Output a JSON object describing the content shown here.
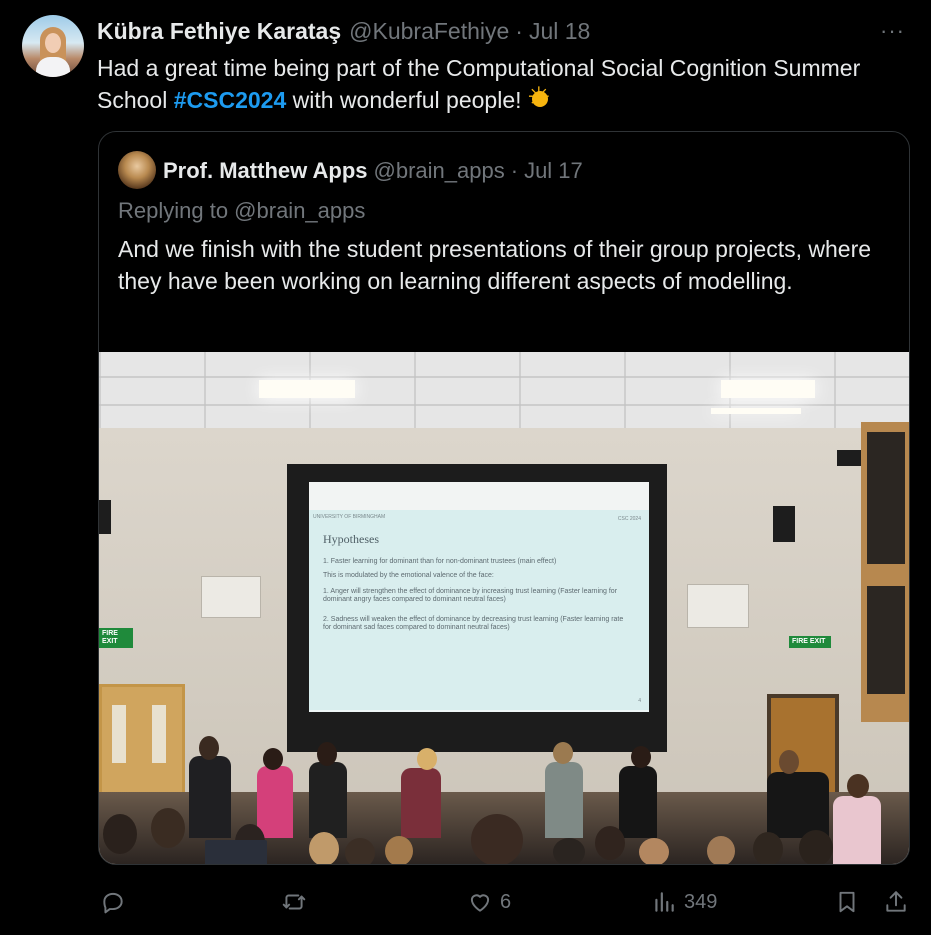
{
  "author": {
    "name": "Kübra Fethiye Karataş",
    "handle": "@KubraFethiye",
    "separator": "·",
    "date": "Jul 18"
  },
  "more_label": "···",
  "tweet": {
    "text_before": "Had a great time being part of the Computational Social Cognition Summer School ",
    "hashtag": "#CSC2024",
    "text_after": " with wonderful people!"
  },
  "quoted": {
    "name": "Prof. Matthew Apps",
    "handle": "@brain_apps",
    "separator": "·",
    "date": "Jul 17",
    "replying": "Replying to @brain_apps",
    "text": "And we finish with the student presentations of their group projects, where they have been working on learning different aspects of modelling."
  },
  "slide": {
    "logo": "UNIVERSITY OF BIRMINGHAM",
    "tag": "CSC 2024",
    "title": "Hypotheses",
    "line1": "1.   Faster learning for dominant than for non-dominant trustees (main effect)",
    "line2": "This is modulated by the emotional valence of the face:",
    "line3": "1.   Anger will strengthen the effect of dominance by increasing trust learning (Faster learning for dominant angry faces compared to dominant neutral faces)",
    "line4": "2.   Sadness will weaken the effect of dominance by decreasing trust learning (Faster learning rate for dominant sad faces compared to dominant neutral faces)",
    "page": "4"
  },
  "signs": {
    "fire_exit": "FIRE EXIT"
  },
  "actions": {
    "reply_count": "",
    "retweet_count": "",
    "like_count": "6",
    "views_count": "349"
  },
  "colors": {
    "background": "#000000",
    "text": "#e7e9ea",
    "muted": "#71767b",
    "link": "#1d9bf0",
    "border": "#2f3336"
  },
  "icons": {
    "reply": "reply-icon",
    "retweet": "retweet-icon",
    "like": "heart-icon",
    "views": "views-icon",
    "bookmark": "bookmark-icon",
    "share": "share-icon",
    "sun": "sun-emoji"
  }
}
